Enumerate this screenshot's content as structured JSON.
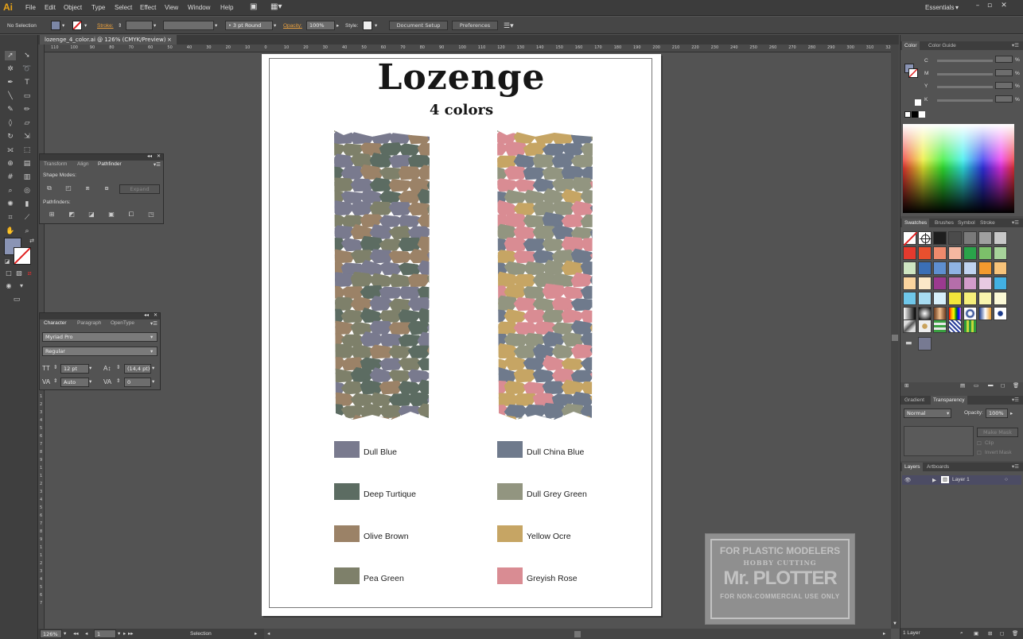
{
  "app": {
    "logo": "Ai",
    "menus": [
      "File",
      "Edit",
      "Object",
      "Type",
      "Select",
      "Effect",
      "View",
      "Window",
      "Help"
    ],
    "workspace": "Essentials"
  },
  "control_bar": {
    "selection": "No Selection",
    "stroke_label": "Stroke:",
    "brush": "3 pt Round",
    "opacity_label": "Opacity:",
    "opacity": "100%",
    "style_label": "Style:",
    "document_setup": "Document Setup",
    "preferences": "Preferences"
  },
  "document_tab": "lozenge_4_color.ai @ 126% (CMYK/Preview)",
  "ruler": {
    "h_ticks": [
      "110",
      "100",
      "90",
      "80",
      "70",
      "60",
      "50",
      "40",
      "30",
      "20",
      "10",
      "0",
      "10",
      "20",
      "30",
      "40",
      "50",
      "60",
      "70",
      "80",
      "90",
      "100",
      "110",
      "120",
      "130",
      "140",
      "150",
      "160",
      "170",
      "180",
      "190",
      "200",
      "210",
      "220",
      "230",
      "240",
      "250",
      "260",
      "270",
      "280",
      "290",
      "300",
      "310",
      "320"
    ],
    "v_ticks": [
      "1",
      "2",
      "3",
      "4",
      "5",
      "6",
      "7",
      "8",
      "9",
      "1",
      "1",
      "2",
      "3",
      "4",
      "5",
      "6",
      "7",
      "8",
      "9",
      "1",
      "1",
      "2",
      "3",
      "4",
      "5",
      "6",
      "7"
    ]
  },
  "artboard": {
    "title": "Lozenge",
    "subtitle": "4 colors",
    "swatches_left": [
      {
        "name": "Dull Blue",
        "color": "#797a8e"
      },
      {
        "name": "Deep Turtique",
        "color": "#5c6c62"
      },
      {
        "name": "Olive Brown",
        "color": "#9b8267"
      },
      {
        "name": "Pea Green",
        "color": "#7e806a"
      }
    ],
    "swatches_right": [
      {
        "name": "Dull China Blue",
        "color": "#6f7a8c"
      },
      {
        "name": "Dull Grey Green",
        "color": "#929580"
      },
      {
        "name": "Yellow Ocre",
        "color": "#c6a564"
      },
      {
        "name": "Greyish Rose",
        "color": "#d98c93"
      }
    ]
  },
  "pathfinder_panel": {
    "tabs": [
      "Transform",
      "Align",
      "Pathfinder"
    ],
    "shape_modes": "Shape Modes:",
    "expand": "Expand",
    "pathfinders": "Pathfinders:"
  },
  "character_panel": {
    "tabs": [
      "Character",
      "Paragraph",
      "OpenType"
    ],
    "font": "Myriad Pro",
    "style": "Regular",
    "size": "12 pt",
    "leading": "(14,4 pt)",
    "kerning": "Auto",
    "tracking": "0"
  },
  "color_panel": {
    "tabs": [
      "Color",
      "Color Guide"
    ],
    "channels": [
      "C",
      "M",
      "Y",
      "K"
    ],
    "unit": "%"
  },
  "swatches_panel": {
    "tabs": [
      "Swatches",
      "Brushes",
      "Symbol",
      "Stroke"
    ],
    "colors": [
      "#ffffff",
      "#ffffff",
      "#1e1e1e",
      "#4b4b4b",
      "#7a7a7a",
      "#a0a0a0",
      "#c8c8c8",
      "#e53a2e",
      "#e8502e",
      "#f08a6c",
      "#f5b7a0",
      "#2aa34a",
      "#7cc06a",
      "#a7d39a",
      "#cfe5c2",
      "#3b6fb6",
      "#5e8fd0",
      "#8fb3e3",
      "#c0d3f0",
      "#f39a2e",
      "#f7c37a",
      "#fad49e",
      "#fbe8c8",
      "#9b3a8f",
      "#b56eaa",
      "#d39ccb",
      "#e7c9e2",
      "#42b0e3",
      "#6fc7ea",
      "#a7dcf2",
      "#d6effa",
      "#f2e63a",
      "#f5ef7a",
      "#f8f4ad",
      "#fbf9d6"
    ]
  },
  "transparency_panel": {
    "tabs": [
      "Gradient",
      "Transparency"
    ],
    "blend": "Normal",
    "opacity_label": "Opacity:",
    "opacity": "100%",
    "make_mask": "Make Mask",
    "clip": "Clip",
    "invert_mask": "Invert Mask"
  },
  "layers_panel": {
    "tabs": [
      "Layers",
      "Artboards"
    ],
    "layer": "Layer 1",
    "count": "1 Layer"
  },
  "status": {
    "zoom": "126%",
    "artboard_no": "1",
    "tool": "Selection"
  },
  "watermark": {
    "line1": "FOR PLASTIC MODELERS",
    "line2": "HOBBY CUTTING",
    "line3": "Mr. PLOTTER",
    "line4": "FOR NON-COMMERCIAL USE ONLY"
  }
}
